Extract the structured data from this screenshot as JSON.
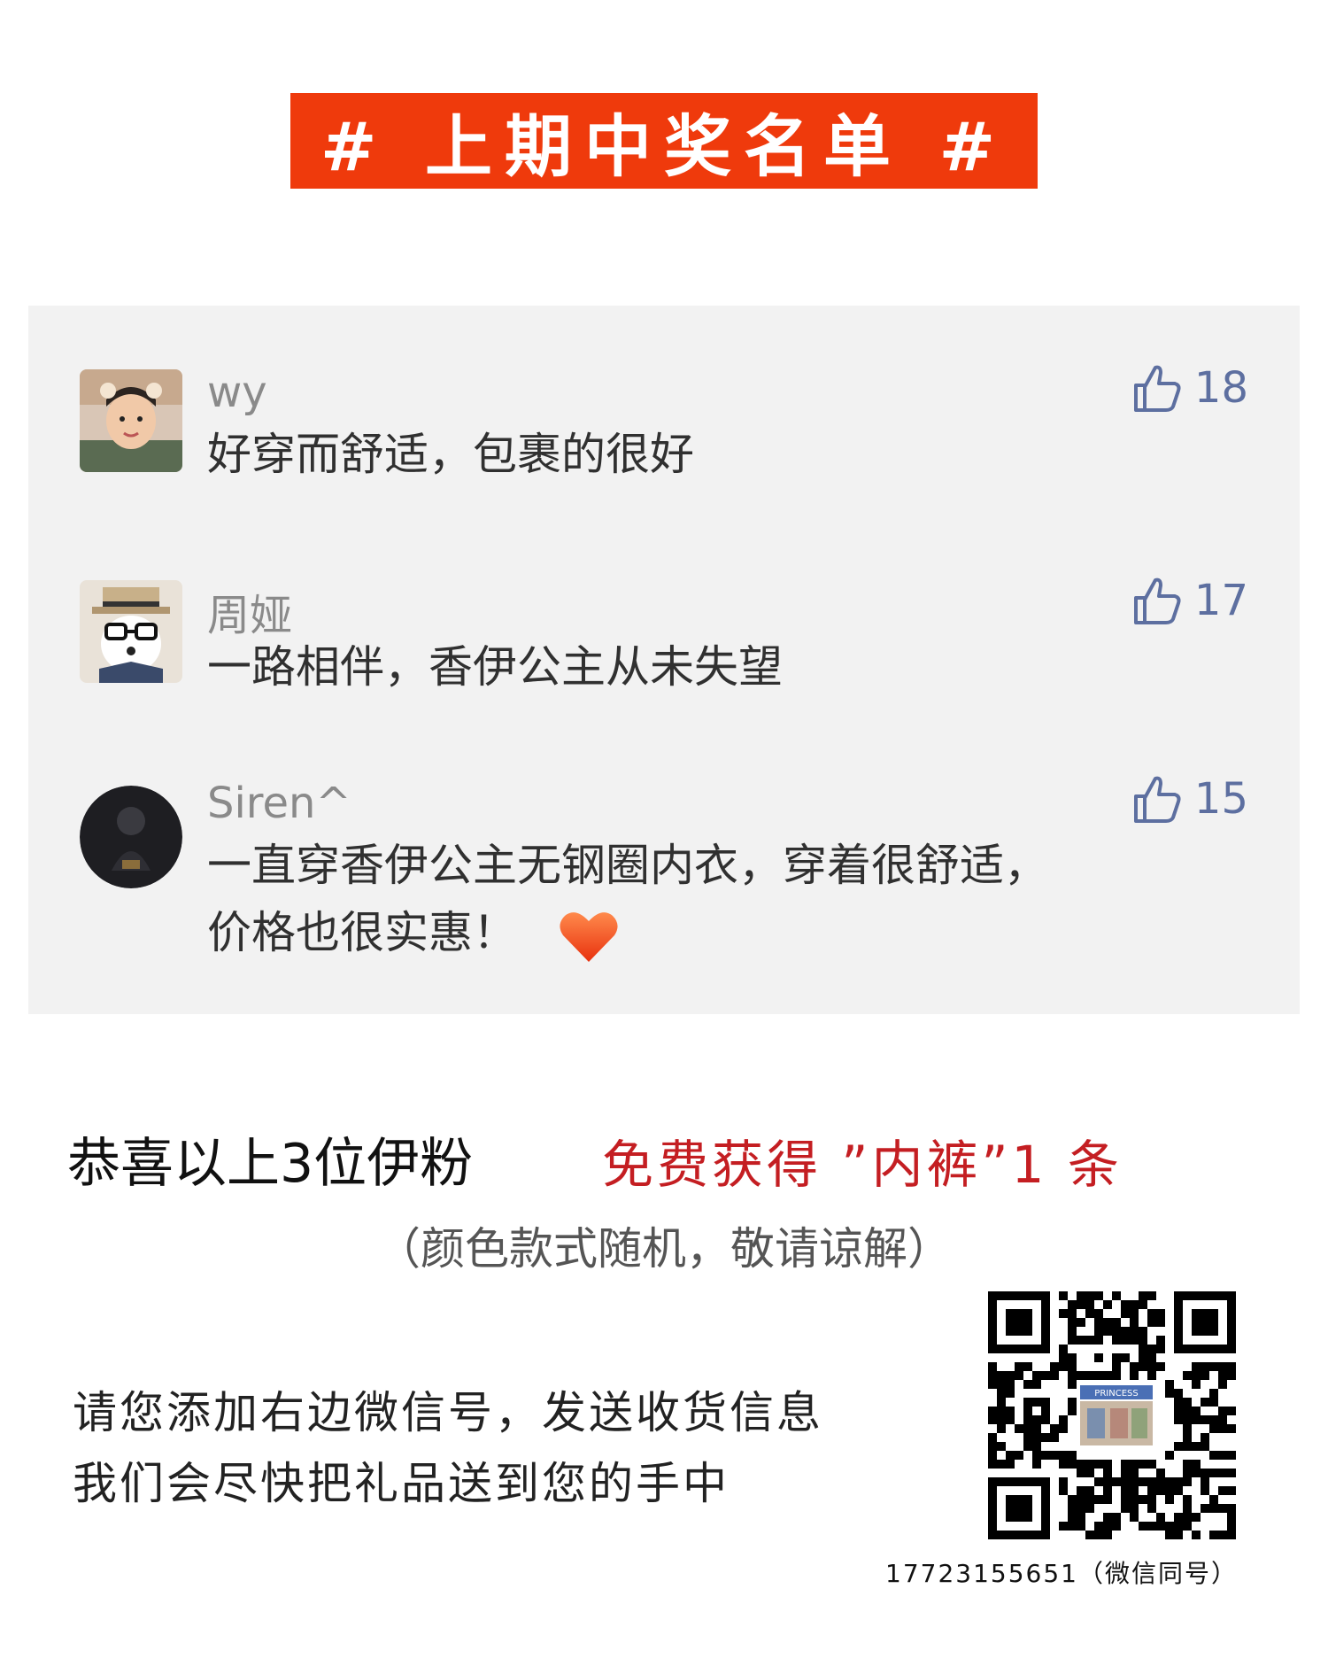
{
  "banner": {
    "title": "# 上期中奖名单 #",
    "color": "#ef3a0c"
  },
  "comments": [
    {
      "name": "wy",
      "text": "好穿而舒适，包裹的很好",
      "likes": "18",
      "avatar": "boy-avatar"
    },
    {
      "name": "周娅",
      "text": "一路相伴，香伊公主从未失望",
      "likes": "17",
      "avatar": "dog-avatar"
    },
    {
      "name": "Siren^",
      "text_line1": "一直穿香伊公主无钢圈内衣，穿着很舒适，",
      "text_line2": "价格也很实惠！",
      "likes": "15",
      "avatar": "dark-avatar",
      "emoji": "heart-icon"
    }
  ],
  "footer": {
    "congrats": "恭喜以上3位伊粉",
    "prize": "免费获得 ”内裤”1 条",
    "note": "（颜色款式随机，敬请谅解）",
    "instruction_line1": "请您添加右边微信号，发送收货信息",
    "instruction_line2": "我们会尽快把礼品送到您的手中",
    "qr_badge": "PRINCESS",
    "wechat": "17723155651（微信同号）"
  },
  "colors": {
    "like": "#5d6fa0",
    "prize": "#c41e22",
    "panel": "#f2f2f2"
  }
}
